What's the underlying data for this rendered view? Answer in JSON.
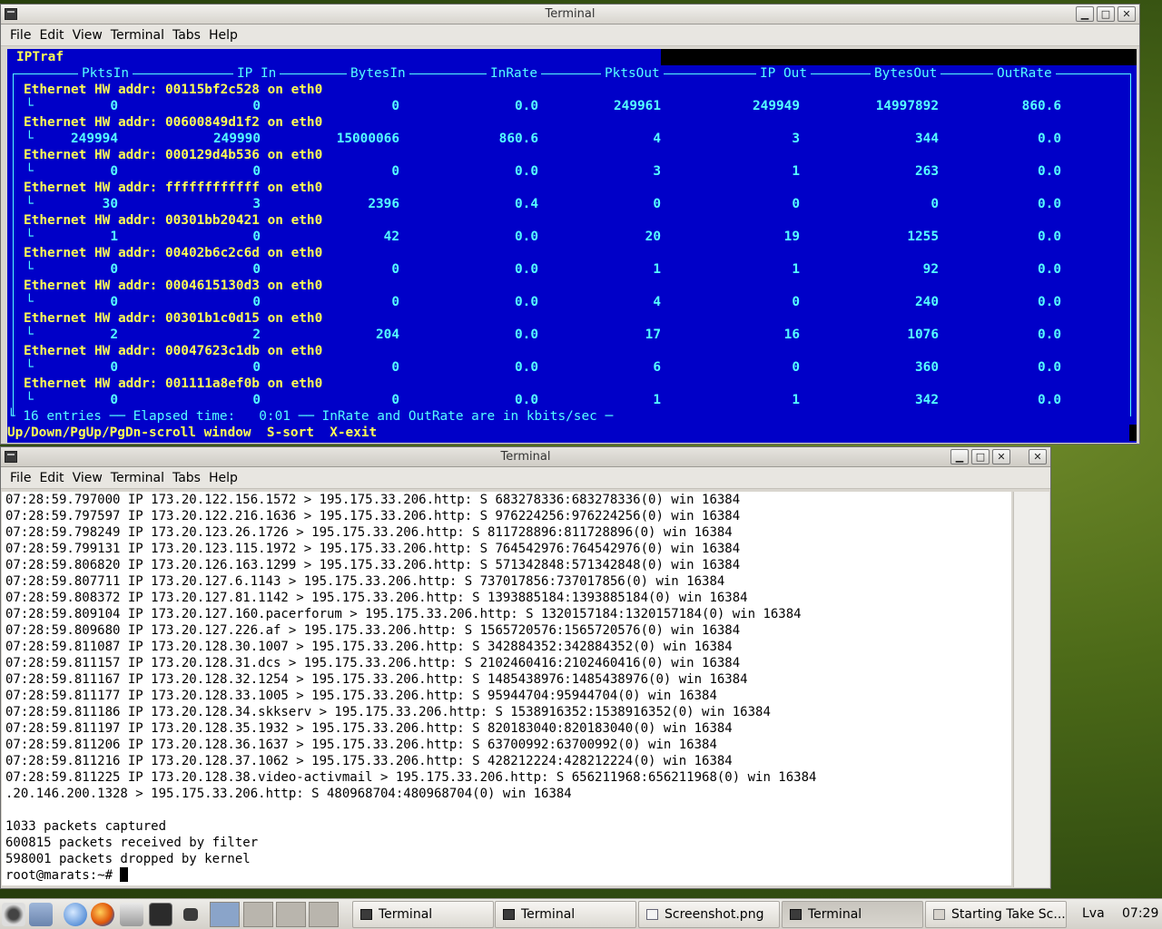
{
  "window1": {
    "title": "Terminal",
    "menu": [
      "File",
      "Edit",
      "View",
      "Terminal",
      "Tabs",
      "Help"
    ],
    "min": "▁",
    "max": "□",
    "close": "✕"
  },
  "iptraf": {
    "title": "IPTraf",
    "headers": [
      "PktsIn",
      "IP In",
      "BytesIn",
      "InRate",
      "PktsOut",
      "IP Out",
      "BytesOut",
      "OutRate"
    ],
    "entries": [
      {
        "addr": "Ethernet HW addr: 00115bf2c528 on eth0",
        "vals": [
          "0",
          "0",
          "0",
          "0.0",
          "249961",
          "249949",
          "14997892",
          "860.6"
        ]
      },
      {
        "addr": "Ethernet HW addr: 00600849d1f2 on eth0",
        "vals": [
          "249994",
          "249990",
          "15000066",
          "860.6",
          "4",
          "3",
          "344",
          "0.0"
        ]
      },
      {
        "addr": "Ethernet HW addr: 000129d4b536 on eth0",
        "vals": [
          "0",
          "0",
          "0",
          "0.0",
          "3",
          "1",
          "263",
          "0.0"
        ]
      },
      {
        "addr": "Ethernet HW addr: ffffffffffff on eth0",
        "vals": [
          "30",
          "3",
          "2396",
          "0.4",
          "0",
          "0",
          "0",
          "0.0"
        ]
      },
      {
        "addr": "Ethernet HW addr: 00301bb20421 on eth0",
        "vals": [
          "1",
          "0",
          "42",
          "0.0",
          "20",
          "19",
          "1255",
          "0.0"
        ]
      },
      {
        "addr": "Ethernet HW addr: 00402b6c2c6d on eth0",
        "vals": [
          "0",
          "0",
          "0",
          "0.0",
          "1",
          "1",
          "92",
          "0.0"
        ]
      },
      {
        "addr": "Ethernet HW addr: 0004615130d3 on eth0",
        "vals": [
          "0",
          "0",
          "0",
          "0.0",
          "4",
          "0",
          "240",
          "0.0"
        ]
      },
      {
        "addr": "Ethernet HW addr: 00301b1c0d15 on eth0",
        "vals": [
          "2",
          "2",
          "204",
          "0.0",
          "17",
          "16",
          "1076",
          "0.0"
        ]
      },
      {
        "addr": "Ethernet HW addr: 00047623c1db on eth0",
        "vals": [
          "0",
          "0",
          "0",
          "0.0",
          "6",
          "0",
          "360",
          "0.0"
        ]
      },
      {
        "addr": "Ethernet HW addr: 001111a8ef0b on eth0",
        "vals": [
          "0",
          "0",
          "0",
          "0.0",
          "1",
          "1",
          "342",
          "0.0"
        ]
      }
    ],
    "status": "└ 16 entries ── Elapsed time:   0:01 ── InRate and OutRate are in kbits/sec ─",
    "keys": "Up/Down/PgUp/PgDn-scroll window  S-sort  X-exit"
  },
  "window2": {
    "title": "Terminal",
    "menu": [
      "File",
      "Edit",
      "View",
      "Terminal",
      "Tabs",
      "Help"
    ],
    "min": "▁",
    "max": "□",
    "close": "✕",
    "lines": [
      "07:28:59.797000 IP 173.20.122.156.1572 > 195.175.33.206.http: S 683278336:683278336(0) win 16384",
      "07:28:59.797597 IP 173.20.122.216.1636 > 195.175.33.206.http: S 976224256:976224256(0) win 16384",
      "07:28:59.798249 IP 173.20.123.26.1726 > 195.175.33.206.http: S 811728896:811728896(0) win 16384",
      "07:28:59.799131 IP 173.20.123.115.1972 > 195.175.33.206.http: S 764542976:764542976(0) win 16384",
      "07:28:59.806820 IP 173.20.126.163.1299 > 195.175.33.206.http: S 571342848:571342848(0) win 16384",
      "07:28:59.807711 IP 173.20.127.6.1143 > 195.175.33.206.http: S 737017856:737017856(0) win 16384",
      "07:28:59.808372 IP 173.20.127.81.1142 > 195.175.33.206.http: S 1393885184:1393885184(0) win 16384",
      "07:28:59.809104 IP 173.20.127.160.pacerforum > 195.175.33.206.http: S 1320157184:1320157184(0) win 16384",
      "07:28:59.809680 IP 173.20.127.226.af > 195.175.33.206.http: S 1565720576:1565720576(0) win 16384",
      "07:28:59.811087 IP 173.20.128.30.1007 > 195.175.33.206.http: S 342884352:342884352(0) win 16384",
      "07:28:59.811157 IP 173.20.128.31.dcs > 195.175.33.206.http: S 2102460416:2102460416(0) win 16384",
      "07:28:59.811167 IP 173.20.128.32.1254 > 195.175.33.206.http: S 1485438976:1485438976(0) win 16384",
      "07:28:59.811177 IP 173.20.128.33.1005 > 195.175.33.206.http: S 95944704:95944704(0) win 16384",
      "07:28:59.811186 IP 173.20.128.34.skkserv > 195.175.33.206.http: S 1538916352:1538916352(0) win 16384",
      "07:28:59.811197 IP 173.20.128.35.1932 > 195.175.33.206.http: S 820183040:820183040(0) win 16384",
      "07:28:59.811206 IP 173.20.128.36.1637 > 195.175.33.206.http: S 63700992:63700992(0) win 16384",
      "07:28:59.811216 IP 173.20.128.37.1062 > 195.175.33.206.http: S 428212224:428212224(0) win 16384",
      "07:28:59.811225 IP 173.20.128.38.video-activmail > 195.175.33.206.http: S 656211968:656211968(0) win 16384",
      ".20.146.200.1328 > 195.175.33.206.http: S 480968704:480968704(0) win 16384",
      "",
      "1033 packets captured",
      "600815 packets received by filter",
      "598001 packets dropped by kernel"
    ],
    "prompt": "root@marats:~# "
  },
  "ghost_close": "✕",
  "taskbar": {
    "tasks": [
      {
        "label": "Terminal",
        "pressed": false
      },
      {
        "label": "Terminal",
        "pressed": false
      },
      {
        "label": "Screenshot.png",
        "pressed": false
      },
      {
        "label": "Terminal",
        "pressed": true
      },
      {
        "label": "Starting Take Sc...",
        "pressed": false
      }
    ],
    "keyboard_layout": "Lva",
    "clock": "07:29"
  }
}
